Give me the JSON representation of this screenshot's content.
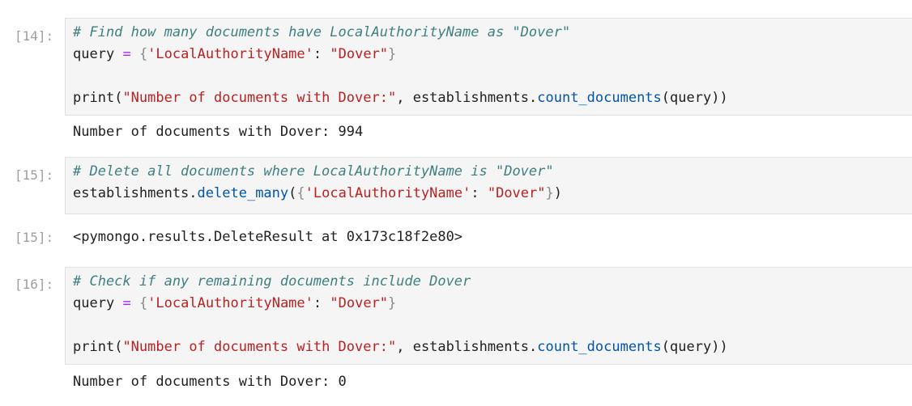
{
  "colors": {
    "comment": "#408080",
    "string": "#ba2121",
    "operator": "#aa22ff",
    "method": "#0055aa",
    "prompt": "#9e9e9e",
    "cell_background": "#f5f5f5"
  },
  "cells": [
    {
      "prompt": "[14]:",
      "comment": "# Find how many documents have LocalAuthorityName as \"Dover\"",
      "query_var": "query",
      "eq": "=",
      "brace_open": "{",
      "key": "'LocalAuthorityName'",
      "colon": ":",
      "value": "\"Dover\"",
      "brace_close": "}",
      "print_fn": "print",
      "paren_open": "(",
      "print_string": "\"Number of documents with Dover:\"",
      "comma": ",",
      "obj": "establishments",
      "dot": ".",
      "method": "count_documents",
      "arg": "query",
      "paren_close": "))",
      "output": "Number of documents with Dover: 994"
    },
    {
      "prompt": "[15]:",
      "comment": "# Delete all documents where LocalAuthorityName is \"Dover\"",
      "obj": "establishments",
      "dot": ".",
      "method": "delete_many",
      "paren_open": "(",
      "brace_open": "{",
      "key": "'LocalAuthorityName'",
      "colon": ":",
      "value": "\"Dover\"",
      "brace_close": "}",
      "paren_close": ")",
      "output_prompt": "[15]:",
      "output": "<pymongo.results.DeleteResult at 0x173c18f2e80>"
    },
    {
      "prompt": "[16]:",
      "comment": "# Check if any remaining documents include Dover",
      "query_var": "query",
      "eq": "=",
      "brace_open": "{",
      "key": "'LocalAuthorityName'",
      "colon": ":",
      "value": "\"Dover\"",
      "brace_close": "}",
      "print_fn": "print",
      "paren_open": "(",
      "print_string": "\"Number of documents with Dover:\"",
      "comma": ",",
      "obj": "establishments",
      "dot": ".",
      "method": "count_documents",
      "arg": "query",
      "paren_close": "))",
      "output": "Number of documents with Dover: 0"
    }
  ]
}
